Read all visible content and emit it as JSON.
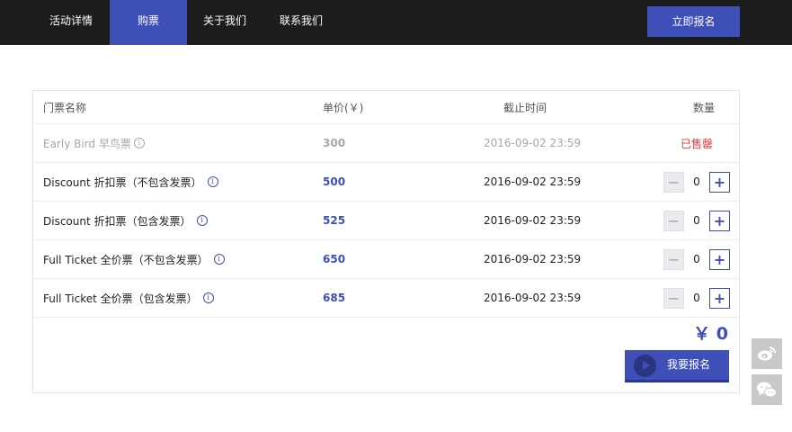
{
  "nav": {
    "items": [
      {
        "label": "活动详情"
      },
      {
        "label": "购票"
      },
      {
        "label": "关于我们"
      },
      {
        "label": "联系我们"
      }
    ],
    "active": "购票",
    "register_label": "立即报名"
  },
  "table": {
    "headers": {
      "name": "门票名称",
      "price": "单价(￥)",
      "deadline": "截止时间",
      "quantity": "数量"
    },
    "rows": [
      {
        "name": "Early Bird 早鸟票",
        "price": "300",
        "deadline": "2016-09-02 23:59",
        "status": "已售罄"
      },
      {
        "name": "Discount 折扣票（不包含发票）",
        "price": "500",
        "deadline": "2016-09-02 23:59",
        "quantity": "0"
      },
      {
        "name": "Discount 折扣票（包含发票）",
        "price": "525",
        "deadline": "2016-09-02 23:59",
        "quantity": "0"
      },
      {
        "name": "Full Ticket 全价票（不包含发票）",
        "price": "650",
        "deadline": "2016-09-02 23:59",
        "quantity": "0"
      },
      {
        "name": "Full Ticket 全价票（包含发票）",
        "price": "685",
        "deadline": "2016-09-02 23:59",
        "quantity": "0"
      }
    ]
  },
  "summary": {
    "total": "￥ 0",
    "submit_label": "我要报名"
  },
  "icons": {
    "info": "info-icon",
    "minus": "minus-icon",
    "plus": "plus-icon",
    "play": "play-icon",
    "weibo": "weibo-icon",
    "wechat": "wechat-icon"
  },
  "colors": {
    "accent": "#3f4fb8",
    "nav_bg": "#1c1c1c",
    "sold_out": "#e23a3a",
    "muted": "#a7a7a7"
  }
}
